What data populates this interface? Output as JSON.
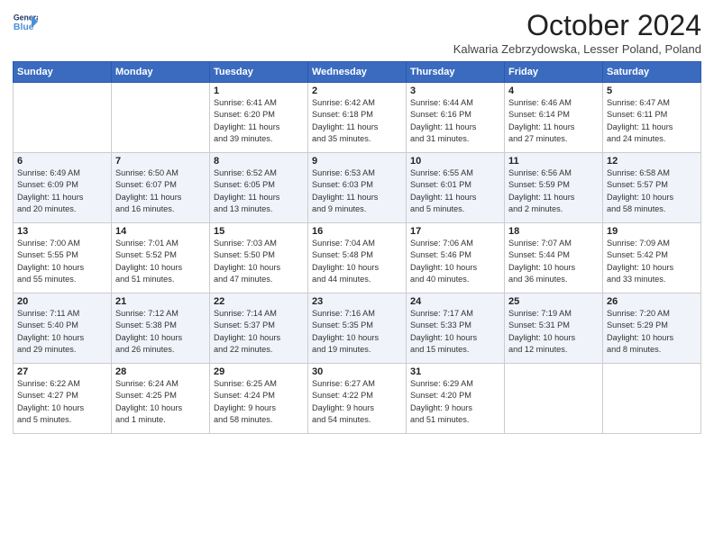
{
  "logo": {
    "line1": "General",
    "line2": "Blue",
    "icon": "▶"
  },
  "title": "October 2024",
  "subtitle": "Kalwaria Zebrzydowska, Lesser Poland, Poland",
  "days_of_week": [
    "Sunday",
    "Monday",
    "Tuesday",
    "Wednesday",
    "Thursday",
    "Friday",
    "Saturday"
  ],
  "weeks": [
    [
      {
        "day": "",
        "info": ""
      },
      {
        "day": "",
        "info": ""
      },
      {
        "day": "1",
        "info": "Sunrise: 6:41 AM\nSunset: 6:20 PM\nDaylight: 11 hours\nand 39 minutes."
      },
      {
        "day": "2",
        "info": "Sunrise: 6:42 AM\nSunset: 6:18 PM\nDaylight: 11 hours\nand 35 minutes."
      },
      {
        "day": "3",
        "info": "Sunrise: 6:44 AM\nSunset: 6:16 PM\nDaylight: 11 hours\nand 31 minutes."
      },
      {
        "day": "4",
        "info": "Sunrise: 6:46 AM\nSunset: 6:14 PM\nDaylight: 11 hours\nand 27 minutes."
      },
      {
        "day": "5",
        "info": "Sunrise: 6:47 AM\nSunset: 6:11 PM\nDaylight: 11 hours\nand 24 minutes."
      }
    ],
    [
      {
        "day": "6",
        "info": "Sunrise: 6:49 AM\nSunset: 6:09 PM\nDaylight: 11 hours\nand 20 minutes."
      },
      {
        "day": "7",
        "info": "Sunrise: 6:50 AM\nSunset: 6:07 PM\nDaylight: 11 hours\nand 16 minutes."
      },
      {
        "day": "8",
        "info": "Sunrise: 6:52 AM\nSunset: 6:05 PM\nDaylight: 11 hours\nand 13 minutes."
      },
      {
        "day": "9",
        "info": "Sunrise: 6:53 AM\nSunset: 6:03 PM\nDaylight: 11 hours\nand 9 minutes."
      },
      {
        "day": "10",
        "info": "Sunrise: 6:55 AM\nSunset: 6:01 PM\nDaylight: 11 hours\nand 5 minutes."
      },
      {
        "day": "11",
        "info": "Sunrise: 6:56 AM\nSunset: 5:59 PM\nDaylight: 11 hours\nand 2 minutes."
      },
      {
        "day": "12",
        "info": "Sunrise: 6:58 AM\nSunset: 5:57 PM\nDaylight: 10 hours\nand 58 minutes."
      }
    ],
    [
      {
        "day": "13",
        "info": "Sunrise: 7:00 AM\nSunset: 5:55 PM\nDaylight: 10 hours\nand 55 minutes."
      },
      {
        "day": "14",
        "info": "Sunrise: 7:01 AM\nSunset: 5:52 PM\nDaylight: 10 hours\nand 51 minutes."
      },
      {
        "day": "15",
        "info": "Sunrise: 7:03 AM\nSunset: 5:50 PM\nDaylight: 10 hours\nand 47 minutes."
      },
      {
        "day": "16",
        "info": "Sunrise: 7:04 AM\nSunset: 5:48 PM\nDaylight: 10 hours\nand 44 minutes."
      },
      {
        "day": "17",
        "info": "Sunrise: 7:06 AM\nSunset: 5:46 PM\nDaylight: 10 hours\nand 40 minutes."
      },
      {
        "day": "18",
        "info": "Sunrise: 7:07 AM\nSunset: 5:44 PM\nDaylight: 10 hours\nand 36 minutes."
      },
      {
        "day": "19",
        "info": "Sunrise: 7:09 AM\nSunset: 5:42 PM\nDaylight: 10 hours\nand 33 minutes."
      }
    ],
    [
      {
        "day": "20",
        "info": "Sunrise: 7:11 AM\nSunset: 5:40 PM\nDaylight: 10 hours\nand 29 minutes."
      },
      {
        "day": "21",
        "info": "Sunrise: 7:12 AM\nSunset: 5:38 PM\nDaylight: 10 hours\nand 26 minutes."
      },
      {
        "day": "22",
        "info": "Sunrise: 7:14 AM\nSunset: 5:37 PM\nDaylight: 10 hours\nand 22 minutes."
      },
      {
        "day": "23",
        "info": "Sunrise: 7:16 AM\nSunset: 5:35 PM\nDaylight: 10 hours\nand 19 minutes."
      },
      {
        "day": "24",
        "info": "Sunrise: 7:17 AM\nSunset: 5:33 PM\nDaylight: 10 hours\nand 15 minutes."
      },
      {
        "day": "25",
        "info": "Sunrise: 7:19 AM\nSunset: 5:31 PM\nDaylight: 10 hours\nand 12 minutes."
      },
      {
        "day": "26",
        "info": "Sunrise: 7:20 AM\nSunset: 5:29 PM\nDaylight: 10 hours\nand 8 minutes."
      }
    ],
    [
      {
        "day": "27",
        "info": "Sunrise: 6:22 AM\nSunset: 4:27 PM\nDaylight: 10 hours\nand 5 minutes."
      },
      {
        "day": "28",
        "info": "Sunrise: 6:24 AM\nSunset: 4:25 PM\nDaylight: 10 hours\nand 1 minute."
      },
      {
        "day": "29",
        "info": "Sunrise: 6:25 AM\nSunset: 4:24 PM\nDaylight: 9 hours\nand 58 minutes."
      },
      {
        "day": "30",
        "info": "Sunrise: 6:27 AM\nSunset: 4:22 PM\nDaylight: 9 hours\nand 54 minutes."
      },
      {
        "day": "31",
        "info": "Sunrise: 6:29 AM\nSunset: 4:20 PM\nDaylight: 9 hours\nand 51 minutes."
      },
      {
        "day": "",
        "info": ""
      },
      {
        "day": "",
        "info": ""
      }
    ]
  ]
}
